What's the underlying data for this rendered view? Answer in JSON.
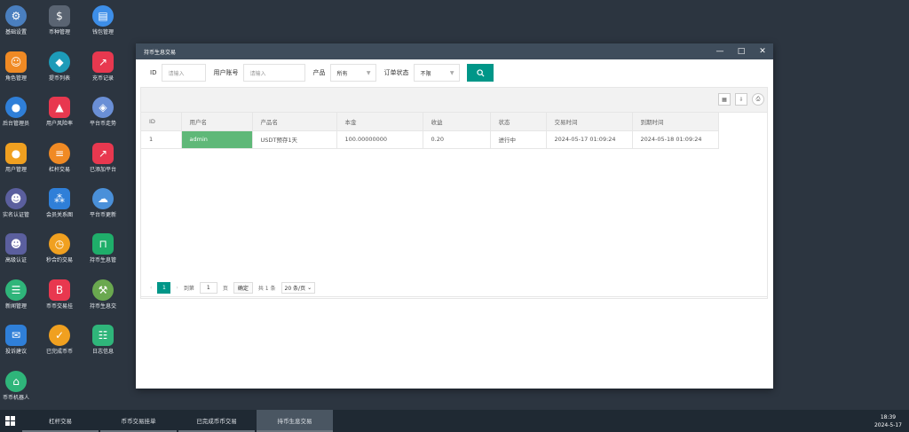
{
  "desktop": {
    "icons": [
      {
        "label": "基础设置",
        "icon": "gear-icon",
        "color": "#4a7fbf"
      },
      {
        "label": "币种管理",
        "icon": "dollar-coin-icon",
        "color": "#5a6472"
      },
      {
        "label": "钱包管理",
        "icon": "wallet-icon",
        "color": "#3d8ee8"
      },
      {
        "label": "角色管理",
        "icon": "people-group-icon",
        "color": "#f08a24"
      },
      {
        "label": "提币列表",
        "icon": "coin-transfer-icon",
        "color": "#1d9bb8"
      },
      {
        "label": "充币记录",
        "icon": "chart-record-icon",
        "color": "#e8384f"
      },
      {
        "label": "后台管理员",
        "icon": "admin-user-icon",
        "color": "#2f7fd8"
      },
      {
        "label": "用户风险率",
        "icon": "alarm-light-icon",
        "color": "#e8384f"
      },
      {
        "label": "平台币走势",
        "icon": "layers-icon",
        "color": "#6a8fd6"
      },
      {
        "label": "用户管理",
        "icon": "user-search-icon",
        "color": "#f0a020"
      },
      {
        "label": "杠杆交易",
        "icon": "stack-icon",
        "color": "#f08a24"
      },
      {
        "label": "已添加平台",
        "icon": "trend-icon",
        "color": "#e8384f"
      },
      {
        "label": "实名认证管",
        "icon": "verify-user-icon",
        "color": "#5b5f9e"
      },
      {
        "label": "会员关系图",
        "icon": "network-icon",
        "color": "#2f7fd8"
      },
      {
        "label": "平台币更新",
        "icon": "cloud-refresh-icon",
        "color": "#4a90d9"
      },
      {
        "label": "高级认证",
        "icon": "advanced-verify-icon",
        "color": "#5b5f9e"
      },
      {
        "label": "秒合约交易",
        "icon": "stopwatch-icon",
        "color": "#f0a020"
      },
      {
        "label": "持币生息管",
        "icon": "unlock-icon",
        "color": "#1fae6a"
      },
      {
        "label": "新闻管理",
        "icon": "document-icon",
        "color": "#2fb57a"
      },
      {
        "label": "币币交易挂",
        "icon": "bitcoin-box-icon",
        "color": "#e8384f"
      },
      {
        "label": "持币生息交",
        "icon": "hammer-icon",
        "color": "#6aa84f"
      },
      {
        "label": "投诉建议",
        "icon": "mail-icon",
        "color": "#2f7fd8"
      },
      {
        "label": "已完成币币",
        "icon": "check-calendar-icon",
        "color": "#f0a020"
      },
      {
        "label": "日志信息",
        "icon": "log-icon",
        "color": "#2fb57a"
      },
      {
        "label": "币币机器人",
        "icon": "robot-icon",
        "color": "#2fb57a"
      }
    ]
  },
  "window": {
    "title": "持币生息交易",
    "controls": {
      "minimize": "—",
      "maximize": "□",
      "close": "✕"
    },
    "filter": {
      "id_label": "ID",
      "id_placeholder": "请输入",
      "account_label": "用户账号",
      "account_placeholder": "请输入",
      "product_label": "产品",
      "product_value": "所有",
      "status_label": "订单状态",
      "status_value": "不限",
      "search_icon": "search-icon"
    },
    "table": {
      "columns": [
        "ID",
        "用户名",
        "产品名",
        "本金",
        "收益",
        "状态",
        "交易时间",
        "到期时间"
      ],
      "rows": [
        [
          "1",
          "admin",
          "USDT预存1天",
          "100.00000000",
          "0.20",
          "进行中",
          "2024-05-17 01:09:24",
          "2024-05-18 01:09:24"
        ]
      ]
    },
    "pager": {
      "prev": "‹",
      "current_page": "1",
      "next": "›",
      "goto_label": "到第",
      "goto_value": "1",
      "page_unit": "页",
      "confirm": "确定",
      "total": "共 1 条",
      "page_size": "20 条/页"
    }
  },
  "taskbar": {
    "tasks": [
      "杠杆交易",
      "币币交易挂单",
      "已完成币币交易",
      "持币生息交易"
    ],
    "active_index": 3,
    "time": "18:39",
    "date": "2024-5-17"
  },
  "colors": {
    "accent": "#009688",
    "highlight_cell": "#5fb878",
    "desktop_bg": "#2c3540",
    "titlebar": "#3f4d5c"
  }
}
